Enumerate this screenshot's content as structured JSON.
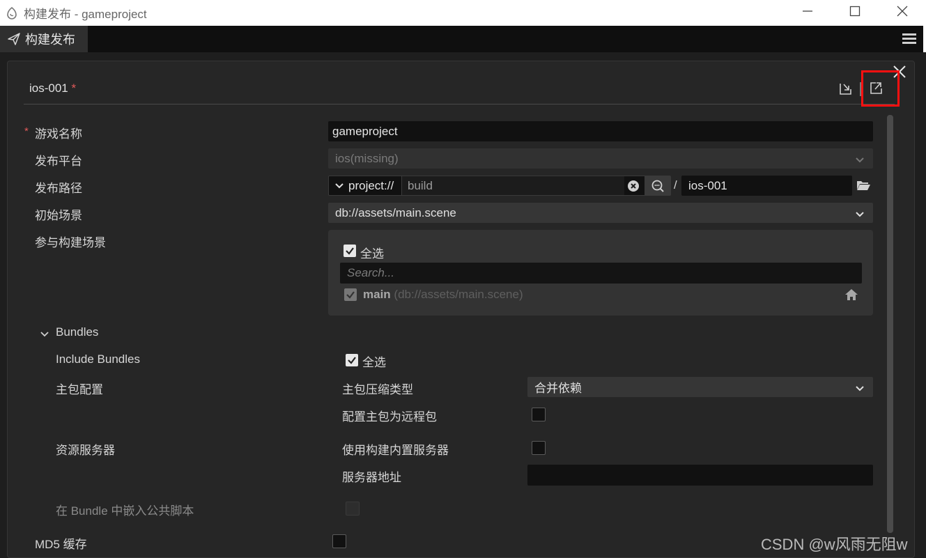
{
  "window": {
    "title": "构建发布 - gameproject"
  },
  "tab": {
    "label": "构建发布"
  },
  "header": {
    "config_name": "ios-001",
    "modified_marker": "*"
  },
  "form": {
    "game_name": {
      "label": "游戏名称",
      "required_marker": "*",
      "value": "gameproject"
    },
    "platform": {
      "label": "发布平台",
      "value": "ios(missing)"
    },
    "build_path": {
      "label": "发布路径",
      "prefix": "project://",
      "path": "build",
      "separator": "/",
      "dest": "ios-001"
    },
    "start_scene": {
      "label": "初始场景",
      "value": "db://assets/main.scene"
    },
    "build_scenes": {
      "label": "参与构建场景",
      "select_all": "全选",
      "search_placeholder": "Search...",
      "scene_name": "main",
      "scene_path": "(db://assets/main.scene)"
    }
  },
  "bundles": {
    "title": "Bundles",
    "include_label": "Include Bundles",
    "include_select_all": "全选",
    "main_config_label": "主包配置",
    "compression_label": "主包压缩类型",
    "compression_value": "合并依赖",
    "remote_label": "配置主包为远程包",
    "server_label": "资源服务器",
    "builtin_server_label": "使用构建内置服务器",
    "server_address_label": "服务器地址",
    "server_address_value": "",
    "embed_label": "在 Bundle 中嵌入公共脚本"
  },
  "md5": {
    "label": "MD5 缓存"
  },
  "watermark": "CSDN @w风雨无阻w",
  "colors": {
    "highlight": "#ff1010",
    "required": "#e05a5a",
    "panel_bg": "#262626"
  }
}
